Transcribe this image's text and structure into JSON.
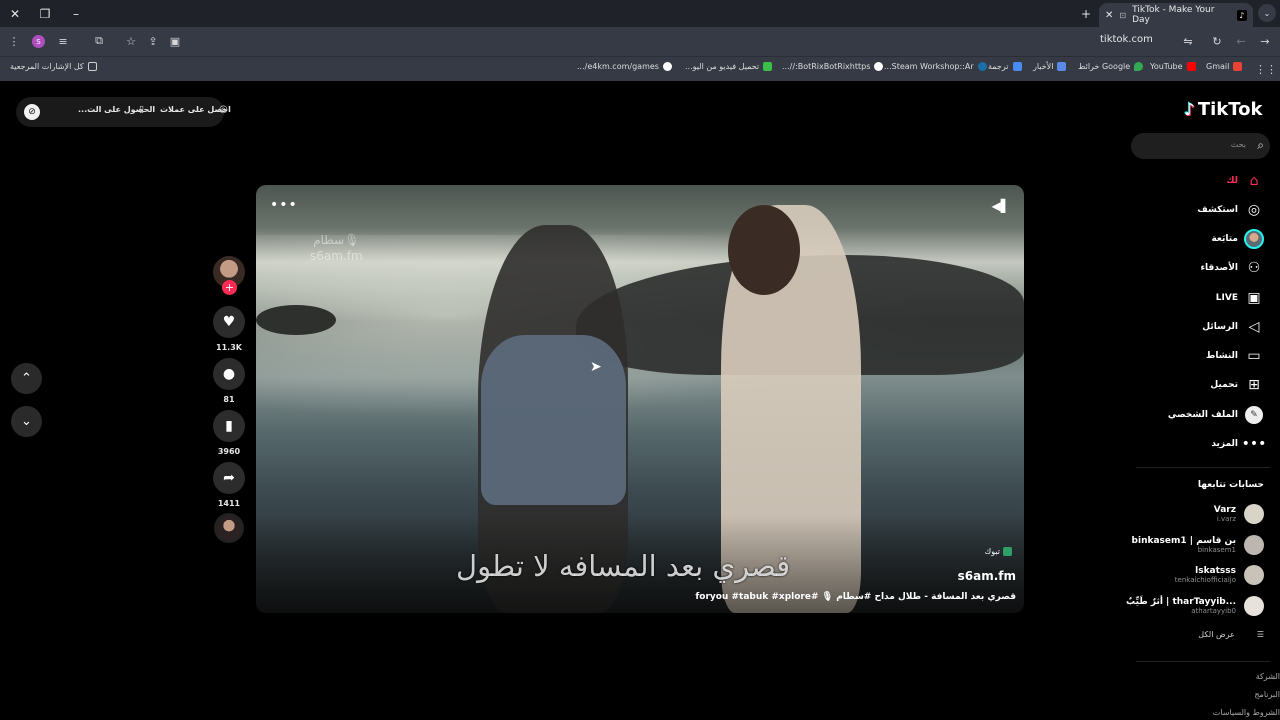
{
  "browser": {
    "tab_title": "TikTok - Make Your Day",
    "url": "tiktok.com",
    "profile_initial": "S",
    "bookmarks": [
      {
        "label": "كل الإشارات المرجعية",
        "color": "#cfcfcf"
      },
      {
        "label": "e4km.com/games/...",
        "color": "#ffffff"
      },
      {
        "label": "تحميل فيديو من اليو...",
        "color": "#3cbf4a"
      },
      {
        "label": "BotRixBotRixhttps://...",
        "color": "#ffffff"
      },
      {
        "label": "Steam Workshop::Ar...",
        "color": "#1b6fa8"
      },
      {
        "label": "ترجمة",
        "color": "#4a8af4"
      },
      {
        "label": "الأخبار",
        "color": "#5a8ae8"
      },
      {
        "label": "Google خرائط",
        "color": "#34a853"
      },
      {
        "label": "YouTube",
        "color": "#ff0000"
      },
      {
        "label": "Gmail",
        "color": "#ea4335"
      }
    ]
  },
  "promo": {
    "coins": "احصل على عملات",
    "app": "الحصول على الت..."
  },
  "video": {
    "more": "•••",
    "watermark_line1": "سطام🎙",
    "watermark_line2": "s6am.fm",
    "caption": "قصري بعد المسافه لا تطول",
    "badge": "تبوك",
    "author": "s6am.fm",
    "description": "قصري بعد المسافة - طلال مداح #سطام 🎙 #foryou #tabuk #xplore"
  },
  "actions": {
    "likes": "11.3K",
    "comments": "81",
    "saves": "3960",
    "shares": "1411"
  },
  "sidebar": {
    "logo": "TikTok",
    "search_placeholder": "بحث",
    "menu": [
      {
        "label": "لك",
        "icon": "home-icon"
      },
      {
        "label": "استكشف",
        "icon": "compass-icon"
      },
      {
        "label": "متابَعة",
        "icon": "avatar"
      },
      {
        "label": "الأصدقاء",
        "icon": "friends-icon"
      },
      {
        "label": "LIVE",
        "icon": "live-icon"
      },
      {
        "label": "الرسائل",
        "icon": "send-icon"
      },
      {
        "label": "النشاط",
        "icon": "activity-icon"
      },
      {
        "label": "تحميل",
        "icon": "upload-icon"
      },
      {
        "label": "الملف الشخصي",
        "icon": "profile-icon"
      },
      {
        "label": "المزيد",
        "icon": "more-icon"
      }
    ],
    "following_title": "حسابات تتابعها",
    "accounts": [
      {
        "name": "Varz",
        "user": "i.varz",
        "color": "#d9d4c8"
      },
      {
        "name": "binkasem1 | بن قاسم",
        "user": "binkasem1",
        "color": "#bdb6b0"
      },
      {
        "name": "lskatsss",
        "user": "tenkaichiofficialjo",
        "color": "#c9c2b8"
      },
      {
        "name": "أثرٌ طَيِّبٌ | tharTayyib...",
        "user": "athartayyib0",
        "color": "#e8e2dc"
      }
    ],
    "see_all": "عرض الكل",
    "footer": [
      "الشركة",
      "البرنامج",
      "الشروط والسياسات"
    ]
  }
}
